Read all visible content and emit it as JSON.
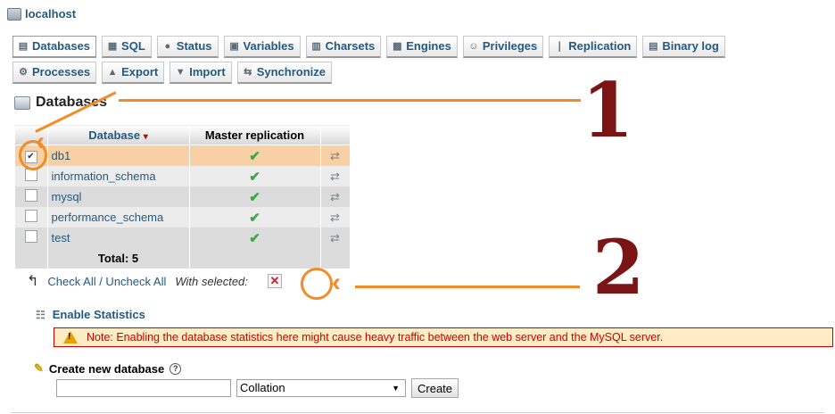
{
  "server": {
    "name": "localhost",
    "icon": "server-icon"
  },
  "tabs_row1": [
    {
      "label": "Databases",
      "icon": "databases-icon",
      "active": true
    },
    {
      "label": "SQL",
      "icon": "sql-icon"
    },
    {
      "label": "Status",
      "icon": "status-icon"
    },
    {
      "label": "Variables",
      "icon": "variables-icon"
    },
    {
      "label": "Charsets",
      "icon": "charsets-icon"
    },
    {
      "label": "Engines",
      "icon": "engines-icon"
    },
    {
      "label": "Privileges",
      "icon": "privileges-icon"
    },
    {
      "label": "Replication",
      "icon": "replication-icon"
    },
    {
      "label": "Binary log",
      "icon": "binary-log-icon"
    }
  ],
  "tabs_row2": [
    {
      "label": "Processes",
      "icon": "processes-icon"
    },
    {
      "label": "Export",
      "icon": "export-icon"
    },
    {
      "label": "Import",
      "icon": "import-icon"
    },
    {
      "label": "Synchronize",
      "icon": "synchronize-icon"
    }
  ],
  "heading": "Databases",
  "table": {
    "headers": {
      "database": "Database",
      "sort_marker": "▾",
      "replication": "Master replication"
    },
    "rows": [
      {
        "name": "db1",
        "checked": true,
        "check_mark": "✔",
        "replication": "✔",
        "action": "⇄"
      },
      {
        "name": "information_schema",
        "checked": false,
        "check_mark": "",
        "replication": "✔",
        "action": "⇄"
      },
      {
        "name": "mysql",
        "checked": false,
        "check_mark": "",
        "replication": "✔",
        "action": "⇄"
      },
      {
        "name": "performance_schema",
        "checked": false,
        "check_mark": "",
        "replication": "✔",
        "action": "⇄"
      },
      {
        "name": "test",
        "checked": false,
        "check_mark": "",
        "replication": "✔",
        "action": "⇄"
      }
    ],
    "total": "Total: 5"
  },
  "bulk": {
    "arrow": "↰",
    "check_all": "Check All / Uncheck All",
    "with_selected": "With selected:",
    "drop_glyph": "✕"
  },
  "annotations": {
    "label1": "1",
    "label2": "2",
    "color": "#f28c28",
    "number_color": "#7b1414"
  },
  "enable_statistics": "Enable Statistics",
  "note": "Note: Enabling the database statistics here might cause heavy traffic between the web server and the MySQL server.",
  "create": {
    "label": "Create new database",
    "help": "?",
    "name_value": "",
    "collation": "Collation",
    "collation_arrow": "▼",
    "button": "Create"
  }
}
